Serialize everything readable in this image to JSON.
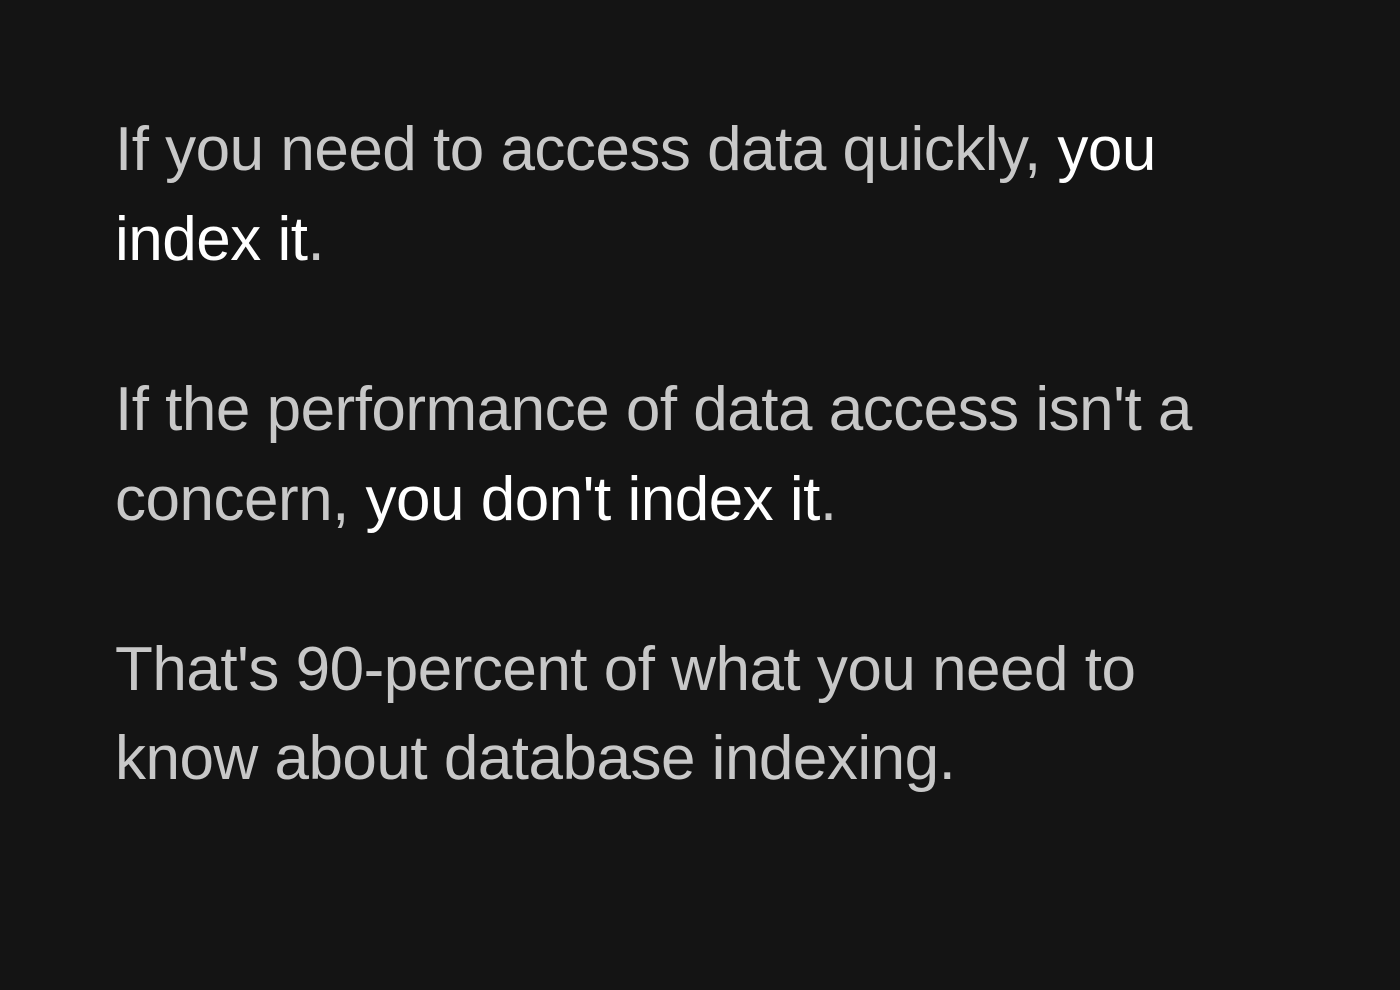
{
  "paragraphs": [
    {
      "parts": [
        {
          "text": "If you need to access data quickly, ",
          "bold": false
        },
        {
          "text": "you index it",
          "bold": true
        },
        {
          "text": ".",
          "bold": false
        }
      ]
    },
    {
      "parts": [
        {
          "text": "If the performance of data access isn't a concern, ",
          "bold": false
        },
        {
          "text": "you don't index it",
          "bold": true
        },
        {
          "text": ".",
          "bold": false
        }
      ]
    },
    {
      "parts": [
        {
          "text": "That's 90-percent of what you need to know about database indexing.",
          "bold": false
        }
      ]
    }
  ]
}
